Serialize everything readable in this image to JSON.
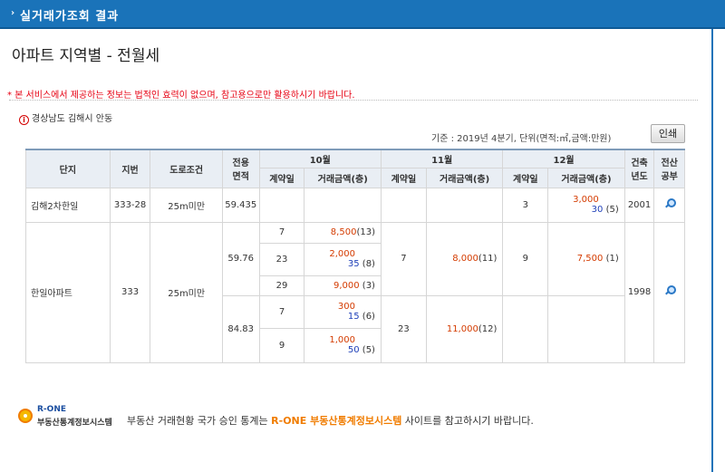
{
  "header": {
    "arrow": "›",
    "title": "실거래가조회 결과"
  },
  "page_title": "아파트 지역별 - 전월세",
  "notice": "* 본 서비스에서 제공하는 정보는 법적인 효력이 없으며, 참고용으로만 활용하시기 바랍니다.",
  "region": {
    "icon": "i",
    "text": "경상남도 김해시 안동"
  },
  "basis": "기준 : 2019년 4분기, 단위(면적:㎡,금액:만원)",
  "print_label": "인쇄",
  "table": {
    "headers": {
      "complex": "단지",
      "lot": "지번",
      "road": "도로조건",
      "area": "전용\n면적",
      "m10": "10월",
      "m11": "11월",
      "m12": "12월",
      "contract_day": "계약일",
      "amount": "거래금액(층)",
      "built": "건축\n년도",
      "records": "전산\n공부"
    },
    "rows": {
      "kimhae": {
        "name": "김해2차한일",
        "lot": "333-28",
        "road": "25m미만",
        "area": "59.435",
        "m12_day": "3",
        "m12_amt1": "3,000",
        "m12_amt2": "30",
        "m12_floor": "(5)",
        "built": "2001"
      },
      "hanil": {
        "name": "한일아파트",
        "lot": "333",
        "road": "25m미만",
        "built": "1998",
        "a1": {
          "area": "59.76",
          "m10": [
            {
              "day": "7",
              "amt": "8,500",
              "floor": "(13)"
            },
            {
              "day": "23",
              "amt1": "2,000",
              "amt2": "35",
              "floor": "(8)"
            },
            {
              "day": "29",
              "amt": "9,000",
              "floor": "(3)"
            }
          ],
          "m11": {
            "day": "7",
            "amt": "8,000",
            "floor": "(11)"
          },
          "m12": {
            "day": "9",
            "amt": "7,500",
            "floor": "(1)"
          }
        },
        "a2": {
          "area": "84.83",
          "m10": [
            {
              "day": "7",
              "amt1": "300",
              "amt2": "15",
              "floor": "(6)"
            },
            {
              "day": "9",
              "amt1": "1,000",
              "amt2": "50",
              "floor": "(5)"
            }
          ],
          "m11": {
            "day": "23",
            "amt": "11,000",
            "floor": "(12)"
          }
        }
      }
    }
  },
  "footer": {
    "logo_en": "R-ONE",
    "logo_kr": "부동산통계정보시스템",
    "text_before": "부동산 거래현황 국가 승인 통계는 ",
    "highlight": "R-ONE 부동산통계정보시스템",
    "text_after": " 사이트를 참고하시기 바랍니다."
  },
  "colors": {
    "topbar": "#1a73b9",
    "notice": "#e60012",
    "accent_orange": "#f07c00",
    "blue_value": "#1e3fb8"
  }
}
